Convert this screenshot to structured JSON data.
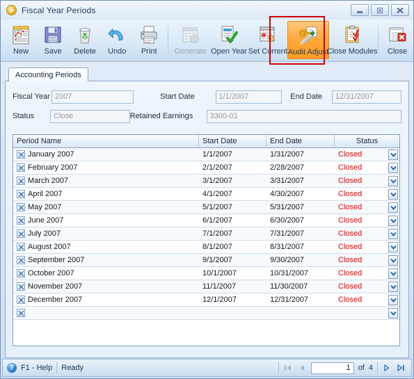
{
  "window": {
    "title": "Fiscal Year Periods",
    "app_icon": "play-circle-icon",
    "controls": {
      "minimize": "Minimize",
      "restore": "Restore",
      "close": "Close"
    }
  },
  "toolbar": {
    "buttons": [
      {
        "label": "New",
        "icon": "new-document-icon",
        "state": "enabled"
      },
      {
        "label": "Save",
        "icon": "floppy-disk-icon",
        "state": "enabled"
      },
      {
        "label": "Delete",
        "icon": "recycle-bin-icon",
        "state": "enabled"
      },
      {
        "label": "Undo",
        "icon": "undo-arrow-icon",
        "state": "enabled"
      },
      {
        "label": "Print",
        "icon": "printer-icon",
        "state": "enabled"
      },
      {
        "label": "Generate",
        "icon": "calendar-gear-icon",
        "state": "disabled"
      },
      {
        "label": "Open Year",
        "icon": "document-check-icon",
        "state": "enabled"
      },
      {
        "label": "Set Current",
        "icon": "calendar-hand-icon",
        "state": "enabled"
      },
      {
        "label": "Audit Adjust",
        "icon": "coins-tools-icon",
        "state": "highlighted"
      },
      {
        "label": "Close Modules",
        "icon": "clipboard-check-icon",
        "state": "enabled"
      },
      {
        "label": "Close",
        "icon": "window-close-icon",
        "state": "enabled"
      }
    ],
    "highlight_color": "#d00000",
    "highlight_target": "Audit Adjust"
  },
  "tabs": [
    {
      "label": "Accounting Periods",
      "selected": true
    }
  ],
  "form": {
    "fiscal_year": {
      "label": "Fiscal Year",
      "value": "2007"
    },
    "start_date": {
      "label": "Start Date",
      "value": "1/1/2007"
    },
    "end_date": {
      "label": "End Date",
      "value": "12/31/2007"
    },
    "status": {
      "label": "Status",
      "value": "Close"
    },
    "retained_earnings": {
      "label": "Retained Earnings",
      "value": "3300-01"
    }
  },
  "grid": {
    "columns": [
      "Period Name",
      "Start Date",
      "End Date",
      "Status"
    ],
    "rows": [
      {
        "name": "January 2007",
        "start": "1/1/2007",
        "end": "1/31/2007",
        "status": "Closed"
      },
      {
        "name": "February 2007",
        "start": "2/1/2007",
        "end": "2/28/2007",
        "status": "Closed"
      },
      {
        "name": "March 2007",
        "start": "3/1/2007",
        "end": "3/31/2007",
        "status": "Closed"
      },
      {
        "name": "April 2007",
        "start": "4/1/2007",
        "end": "4/30/2007",
        "status": "Closed"
      },
      {
        "name": "May 2007",
        "start": "5/1/2007",
        "end": "5/31/2007",
        "status": "Closed"
      },
      {
        "name": "June 2007",
        "start": "6/1/2007",
        "end": "6/30/2007",
        "status": "Closed"
      },
      {
        "name": "July 2007",
        "start": "7/1/2007",
        "end": "7/31/2007",
        "status": "Closed"
      },
      {
        "name": "August 2007",
        "start": "8/1/2007",
        "end": "8/31/2007",
        "status": "Closed"
      },
      {
        "name": "September 2007",
        "start": "9/1/2007",
        "end": "9/30/2007",
        "status": "Closed"
      },
      {
        "name": "October 2007",
        "start": "10/1/2007",
        "end": "10/31/2007",
        "status": "Closed"
      },
      {
        "name": "November 2007",
        "start": "11/1/2007",
        "end": "11/30/2007",
        "status": "Closed"
      },
      {
        "name": "December 2007",
        "start": "12/1/2007",
        "end": "12/31/2007",
        "status": "Closed"
      },
      {
        "name": "",
        "start": "",
        "end": "",
        "status": ""
      }
    ],
    "status_color": "#e00000",
    "row_delete_icon": "x-icon",
    "status_dropdown_icon": "chevron-down-icon"
  },
  "statusbar": {
    "help_label": "F1 - Help",
    "help_icon": "question-circle-icon",
    "message": "Ready",
    "pager": {
      "first_icon": "first-page-icon",
      "prev_icon": "previous-page-icon",
      "current": "1",
      "of_label": "of",
      "total": "4",
      "next_icon": "next-page-icon",
      "last_icon": "last-page-icon"
    }
  }
}
